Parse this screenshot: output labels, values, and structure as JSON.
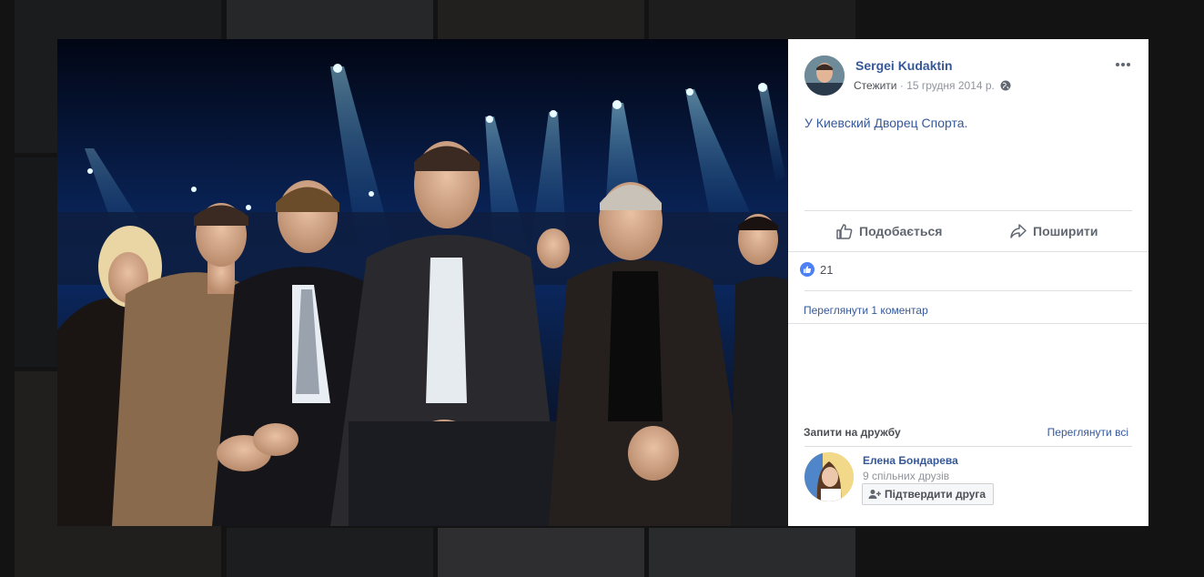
{
  "post": {
    "author": "Sergei Kudaktin",
    "follow_label": "Стежити",
    "separator": "·",
    "date": "15 грудня 2014 р.",
    "privacy_icon": "globe-icon",
    "text": "У Киевский Дворец Спорта."
  },
  "actions": {
    "like_label": "Подобається",
    "share_label": "Поширити"
  },
  "reactions": {
    "count": "21"
  },
  "comments": {
    "view_label": "Переглянути 1 коментар"
  },
  "friend_requests": {
    "title": "Запити на дружбу",
    "view_all": "Переглянути всі",
    "items": [
      {
        "name": "Елена Бондарева",
        "mutual": "9 спільних друзів",
        "confirm_label": "Підтвердити друга"
      }
    ]
  },
  "colors": {
    "link": "#365899",
    "like_blue": "#4d7ff5",
    "panel_bg": "#ffffff"
  }
}
